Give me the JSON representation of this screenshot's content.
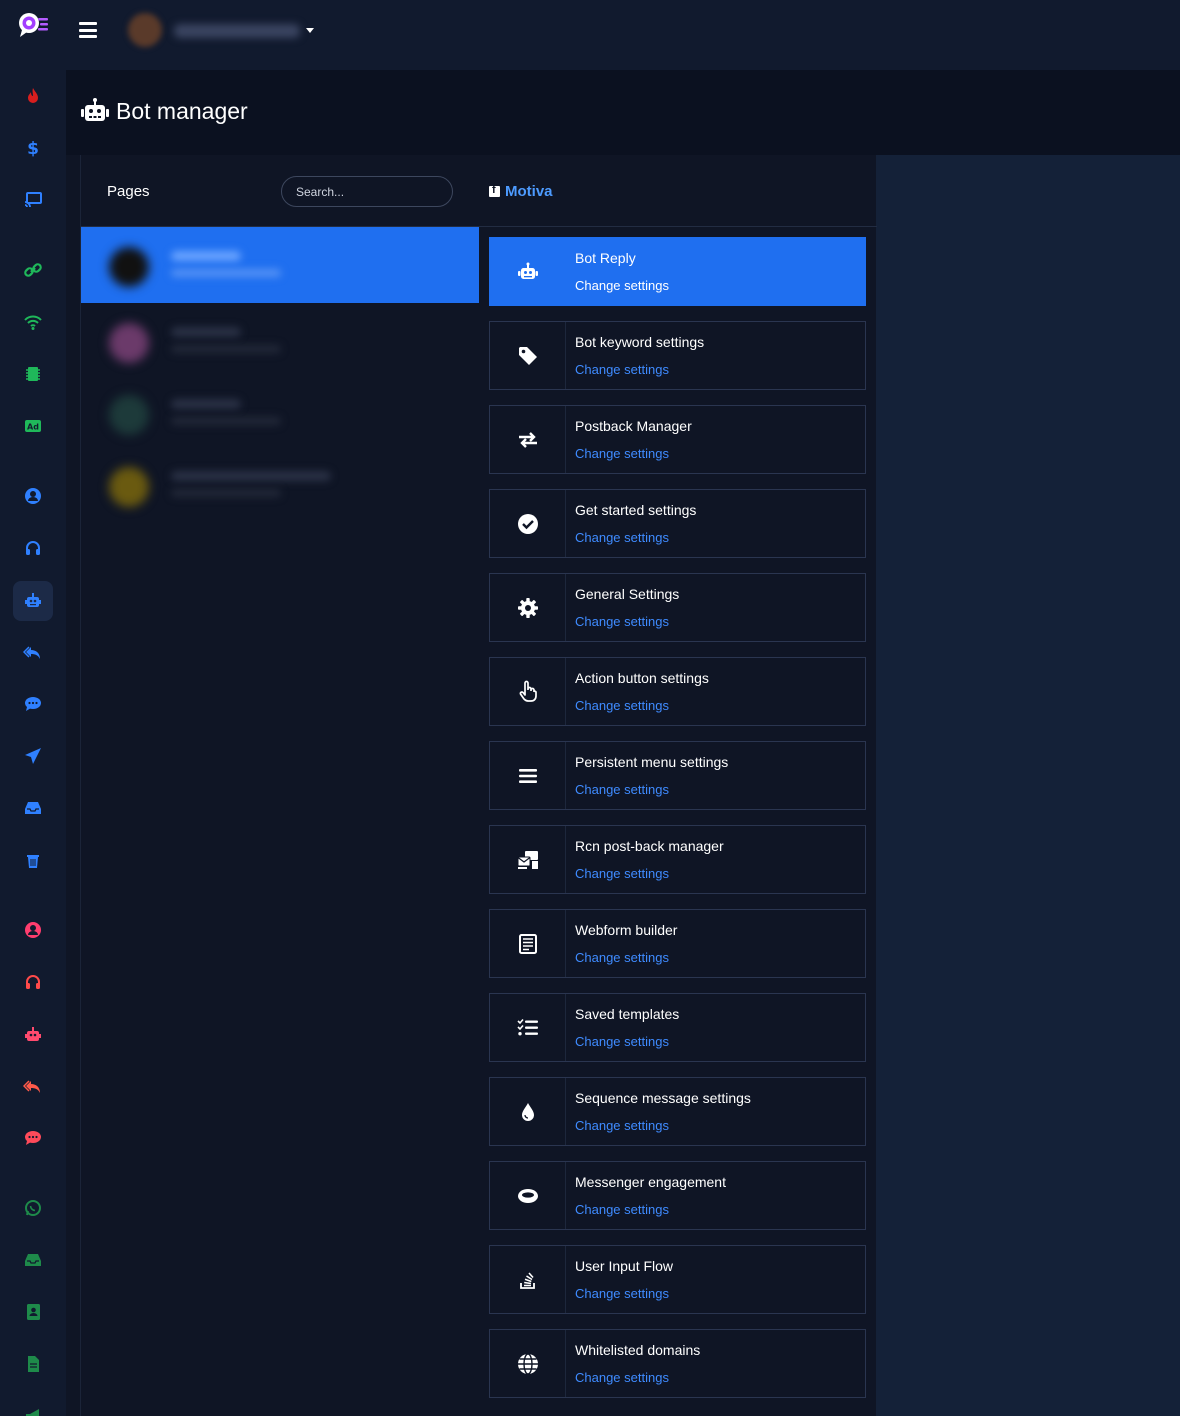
{
  "header": {
    "title": "Bot manager"
  },
  "pages_panel": {
    "label": "Pages",
    "search_placeholder": "Search..."
  },
  "selected_page": {
    "name": "Motiva"
  },
  "settings_cards": [
    {
      "title": "Bot Reply",
      "link": "Change settings",
      "icon": "robot-icon"
    },
    {
      "title": "Bot keyword settings",
      "link": "Change settings",
      "icon": "tag-icon"
    },
    {
      "title": "Postback Manager",
      "link": "Change settings",
      "icon": "exchange-icon"
    },
    {
      "title": "Get started settings",
      "link": "Change settings",
      "icon": "check-circle-icon"
    },
    {
      "title": "General Settings",
      "link": "Change settings",
      "icon": "gear-icon"
    },
    {
      "title": "Action button settings",
      "link": "Change settings",
      "icon": "hand-pointer-icon"
    },
    {
      "title": "Persistent menu settings",
      "link": "Change settings",
      "icon": "menu-bars-icon"
    },
    {
      "title": "Rcn post-back manager",
      "link": "Change settings",
      "icon": "mail-bulk-icon"
    },
    {
      "title": "Webform builder",
      "link": "Change settings",
      "icon": "form-icon"
    },
    {
      "title": "Saved templates",
      "link": "Change settings",
      "icon": "tasks-list-icon"
    },
    {
      "title": "Sequence message settings",
      "link": "Change settings",
      "icon": "drop-icon"
    },
    {
      "title": "Messenger engagement",
      "link": "Change settings",
      "icon": "ring-icon"
    },
    {
      "title": "User Input Flow",
      "link": "Change settings",
      "icon": "stack-overflow-icon"
    },
    {
      "title": "Whitelisted domains",
      "link": "Change settings",
      "icon": "globe-icon"
    }
  ],
  "colors": {
    "accent": "#1f6ff0",
    "link": "#3f8bff",
    "background": "#0f1525",
    "sidebar": "#111a2e"
  }
}
